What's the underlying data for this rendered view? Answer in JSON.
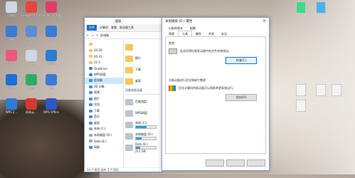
{
  "desktop": {
    "left_icons": [
      {
        "label": "回收站",
        "icon": "recycle-bin-icon",
        "color": "#cfd8e3"
      },
      {
        "label": "Google Chrome",
        "icon": "chrome-icon",
        "color": "#e8453c"
      },
      {
        "label": "360安全浏览器",
        "icon": "browser-icon",
        "color": "#e23c6a"
      },
      {
        "label": "网络",
        "icon": "network-icon",
        "color": "#3a7bd5"
      },
      {
        "label": "控制面板",
        "icon": "control-panel-icon",
        "color": "#5a8fd8"
      },
      {
        "label": "搜狗",
        "icon": "sougou-icon",
        "color": "#3a7bd5"
      },
      {
        "label": "360",
        "icon": "360-icon",
        "color": "#e95b7a"
      },
      {
        "label": "网络",
        "icon": "globe-icon",
        "color": "#cfd8e3"
      },
      {
        "label": "此电脑",
        "icon": "edge-icon",
        "color": "#2b7cd3"
      },
      {
        "label": "迅雷",
        "icon": "star-app-icon",
        "color": "#1d6fd6"
      },
      {
        "label": "微信",
        "icon": "wechat-icon",
        "color": "#2aae67"
      },
      {
        "label": "飞书",
        "icon": "flag-app-icon",
        "color": "#3a7bd5"
      },
      {
        "label": "WPS 2...",
        "icon": "wps-icon",
        "color": "#2b7cd3"
      },
      {
        "label": "网易云...",
        "icon": "netease-icon",
        "color": "#d33a31"
      },
      {
        "label": "WPS Office",
        "icon": "wps-office-icon",
        "color": "#2b57c9"
      }
    ],
    "right_files": [
      {
        "label": "",
        "icon": "android-icon",
        "color": "#3ddc84"
      },
      {
        "label": "",
        "icon": "app-icon",
        "color": "#48b3e6"
      },
      {
        "label": "",
        "icon": "doc-icon",
        "color": "#f4f4f4"
      },
      {
        "label": "",
        "icon": "doc-icon",
        "color": "#f4f4f4"
      },
      {
        "label": "",
        "icon": "doc-icon",
        "color": "#f4f4f4"
      },
      {
        "label": "",
        "icon": "doc-icon",
        "color": "#f4f4f4"
      }
    ]
  },
  "explorer": {
    "title": "管理",
    "ribbon": {
      "file": "文件",
      "tabs": [
        "计算机",
        "查看",
        "驱动器工具"
      ]
    },
    "address": "此电脑",
    "nav": [
      {
        "label": "",
        "type": "folder"
      },
      {
        "label": "10-26",
        "type": "folder"
      },
      {
        "label": "10-31",
        "type": "folder"
      },
      {
        "label": "11-1",
        "type": "folder"
      },
      {
        "label": "OneDrive",
        "type": "cloud"
      },
      {
        "label": "WPS网盘",
        "type": "cloud"
      },
      {
        "label": "此电脑",
        "type": "pc",
        "selected": true
      },
      {
        "label": "3D 对象",
        "type": "blue"
      },
      {
        "label": "视频",
        "type": "blue"
      },
      {
        "label": "图片",
        "type": "blue"
      },
      {
        "label": "文档",
        "type": "blue"
      },
      {
        "label": "下载",
        "type": "blue"
      },
      {
        "label": "音乐",
        "type": "blue"
      },
      {
        "label": "桌面",
        "type": "blue"
      },
      {
        "label": "系统 (C:)",
        "type": "drive"
      },
      {
        "label": "本地磁盘 (D:)",
        "type": "drive"
      },
      {
        "label": "Data (E:)",
        "type": "drive"
      },
      {
        "label": "网络",
        "type": "pc"
      }
    ],
    "content": {
      "folders": [
        "",
        "图片",
        "下载",
        "桌面"
      ],
      "group_label": "设备和驱动器",
      "drives": [
        {
          "name": "百度网盘",
          "free": ""
        },
        {
          "name": "WPS网盘",
          "free": ""
        },
        {
          "name": "系统 (C:)",
          "free": "",
          "usage": 0.55
        },
        {
          "name": "本地磁盘 (D:)",
          "free": "",
          "usage": 0.3
        },
        {
          "name": "Data (E:)",
          "free": "211 GB",
          "usage": 0.2
        }
      ]
    },
    "status": "14 个项目   选中 1 个项目"
  },
  "dialog": {
    "title": "本地磁盘 (D:) 属性",
    "tabs_row1": [
      "以前的版本",
      "配额"
    ],
    "tabs_row2": [
      "常规",
      "工具",
      "硬件",
      "共享",
      "安全"
    ],
    "active_tab": "工具",
    "error_check": {
      "heading": "查错",
      "description": "此选项将检查驱动器中的文件系统错误。",
      "button": "检查(C)"
    },
    "optimize": {
      "heading": "对驱动器进行优化和碎片整理",
      "description": "优化计算机的驱动器可以帮助其更高效运行。",
      "button": "优化(O)"
    },
    "footer_buttons": [
      "",
      "",
      ""
    ]
  }
}
